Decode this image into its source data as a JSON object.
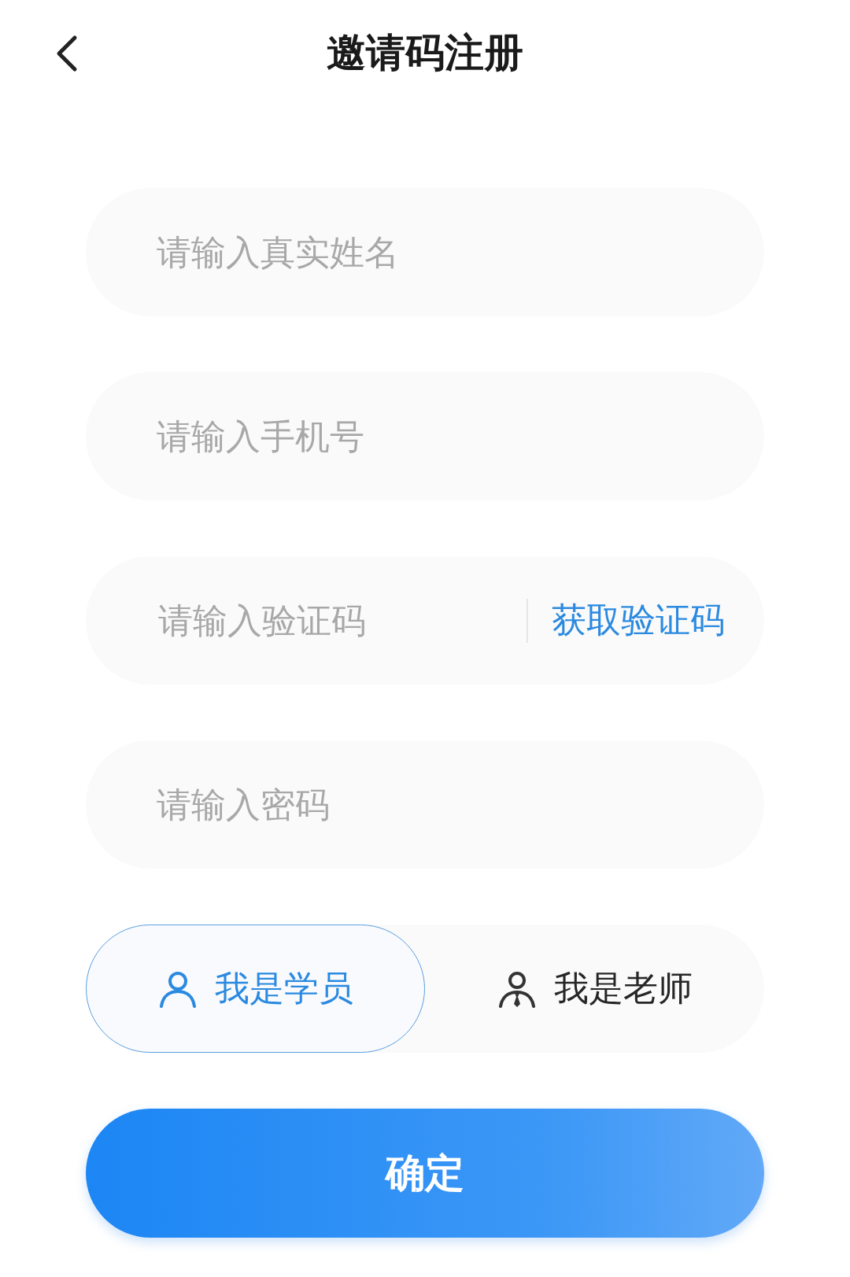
{
  "header": {
    "title": "邀请码注册"
  },
  "fields": [
    {
      "placeholder": "请输入真实姓名"
    },
    {
      "placeholder": "请输入手机号"
    },
    {
      "placeholder": "请输入验证码",
      "action": "获取验证码"
    },
    {
      "placeholder": "请输入密码"
    }
  ],
  "roles": [
    {
      "kind": "student",
      "label": "我是学员",
      "selected": true
    },
    {
      "kind": "teacher",
      "label": "我是老师",
      "selected": false
    }
  ],
  "submit": {
    "label": "确定"
  }
}
